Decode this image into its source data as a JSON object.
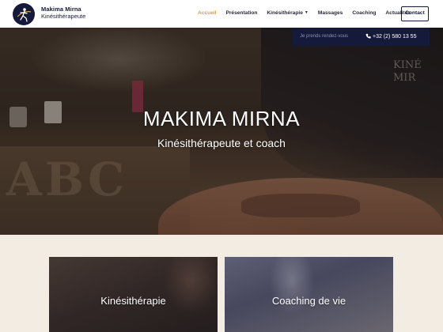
{
  "brand": {
    "name": "Makima Mirna",
    "subtitle": "Kinésithérapeute"
  },
  "nav": {
    "items": [
      {
        "label": "Accueil",
        "active": true
      },
      {
        "label": "Présentation"
      },
      {
        "label": "Kinésithérapie",
        "has_dropdown": true
      },
      {
        "label": "Massages"
      },
      {
        "label": "Coaching"
      },
      {
        "label": "Actualités"
      }
    ],
    "contact_label": "Contact"
  },
  "info_bar": {
    "text": "Je prends rendez-vous",
    "phone": "+32 (2) 580 13 55"
  },
  "hero": {
    "title": "MAKIMA MIRNA",
    "subtitle": "Kinésithérapeute et coach",
    "background_decor_text": "ABC",
    "shirt_text": [
      "KINÉ",
      "MIR"
    ]
  },
  "cards": [
    {
      "label": "Kinésithérapie"
    },
    {
      "label": "Coaching de vie"
    }
  ],
  "colors": {
    "navy": "#15193a",
    "accent_gold": "#d4a24a",
    "page_bg": "#f3ece2"
  },
  "icons": {
    "phone": "phone-icon",
    "logo": "runner-logo-icon",
    "dropdown": "chevron-down-icon"
  }
}
